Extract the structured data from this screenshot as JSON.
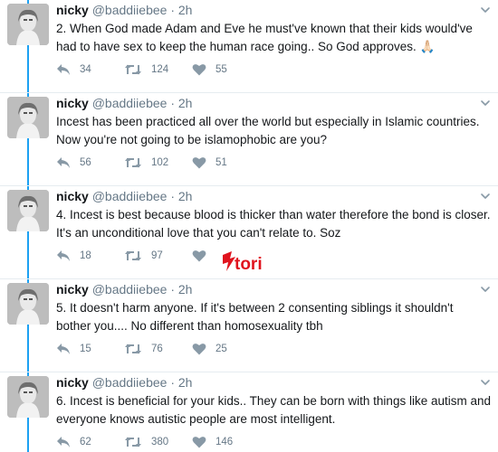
{
  "tweets": [
    {
      "name": "nicky",
      "handle": "@baddiiebee",
      "separator": "·",
      "time": "2h",
      "text": "2. When God made Adam and Eve he must've known that their kids would've had to have sex to keep the human race going.. So God approves. 🙏🏻",
      "replies": "34",
      "retweets": "124",
      "likes": "55"
    },
    {
      "name": "nicky",
      "handle": "@baddiiebee",
      "separator": "·",
      "time": "2h",
      "text": "Incest has been practiced all over the world but especially in Islamic countries. Now you're not going to be islamophobic are you?",
      "replies": "56",
      "retweets": "102",
      "likes": "51"
    },
    {
      "name": "nicky",
      "handle": "@baddiiebee",
      "separator": "·",
      "time": "2h",
      "text": "4. Incest is best because blood is thicker than water therefore the bond is closer. It's an unconditional love that you can't relate to. Soz",
      "replies": "18",
      "retweets": "97",
      "likes": ""
    },
    {
      "name": "nicky",
      "handle": "@baddiiebee",
      "separator": "·",
      "time": "2h",
      "text": "5. It doesn't harm anyone. If it's between 2 consenting siblings it shouldn't bother you.... No different than homosexuality tbh",
      "replies": "15",
      "retweets": "76",
      "likes": "25"
    },
    {
      "name": "nicky",
      "handle": "@baddiiebee",
      "separator": "·",
      "time": "2h",
      "text": "6. Incest is beneficial for your kids.. They can be born with things like autism and everyone knows autistic people are most intelligent.",
      "replies": "62",
      "retweets": "380",
      "likes": "146"
    }
  ],
  "watermark": {
    "text": "tori",
    "color": "#e0141e"
  },
  "colors": {
    "thread": "#1da1f2",
    "muted": "#657786",
    "text": "#14171a"
  },
  "icons": {
    "reply": "reply-icon",
    "retweet": "retweet-icon",
    "like": "heart-icon",
    "caret": "chevron-down-icon"
  }
}
